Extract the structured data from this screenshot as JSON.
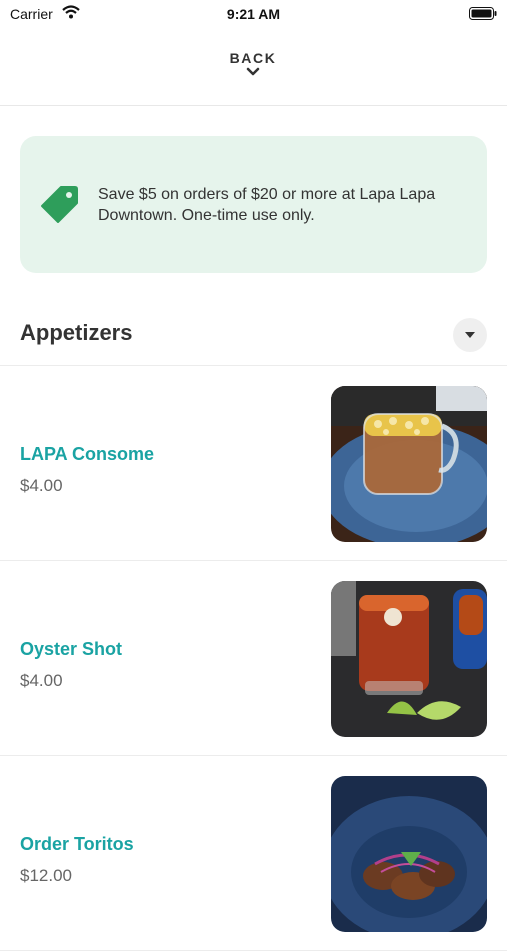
{
  "status_bar": {
    "carrier": "Carrier",
    "time": "9:21 AM"
  },
  "header": {
    "back_label": "BACK"
  },
  "promo": {
    "text": "Save $5 on orders of $20 or more at Lapa Lapa Downtown. One-time use only."
  },
  "section": {
    "title": "Appetizers"
  },
  "items": [
    {
      "name": "LAPA Consome",
      "price": "$4.00"
    },
    {
      "name": "Oyster Shot",
      "price": "$4.00"
    },
    {
      "name": "Order Toritos",
      "price": "$12.00"
    }
  ],
  "colors": {
    "accent": "#1aa3a3",
    "promo_bg": "#e6f4ec",
    "tag_green": "#2e9e5b"
  }
}
